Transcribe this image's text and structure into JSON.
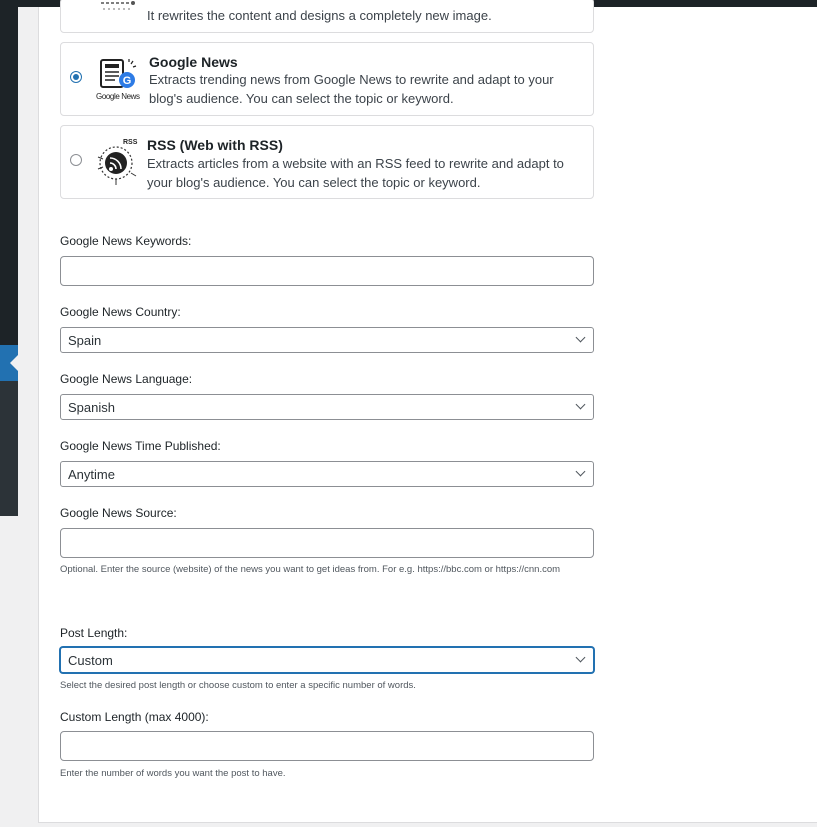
{
  "options": {
    "prev_desc": "It rewrites the content and designs a completely new image.",
    "google_news": {
      "title": "Google News",
      "logo_text": "Google News",
      "desc": "Extracts trending news from Google News to rewrite and adapt to your blog's audience. You can select the topic or keyword."
    },
    "rss": {
      "title": "RSS (Web with RSS)",
      "logo_text": "RSS",
      "desc": "Extracts articles from a website with an RSS feed to rewrite and adapt to your blog's audience. You can select the topic or keyword."
    }
  },
  "form": {
    "keywords": {
      "label": "Google News Keywords:",
      "value": ""
    },
    "country": {
      "label": "Google News Country:",
      "value": "Spain"
    },
    "language": {
      "label": "Google News Language:",
      "value": "Spanish"
    },
    "time": {
      "label": "Google News Time Published:",
      "value": "Anytime"
    },
    "source": {
      "label": "Google News Source:",
      "value": "",
      "help": "Optional. Enter the source (website) of the news you want to get ideas from. For e.g. https://bbc.com or https://cnn.com"
    },
    "post_length": {
      "label": "Post Length:",
      "value": "Custom",
      "help": "Select the desired post length or choose custom to enter a specific number of words."
    },
    "custom_length": {
      "label": "Custom Length (max 4000):",
      "value": "",
      "help": "Enter the number of words you want the post to have."
    }
  },
  "colors": {
    "accent": "#2271b1",
    "admin_bar": "#1d2327"
  }
}
